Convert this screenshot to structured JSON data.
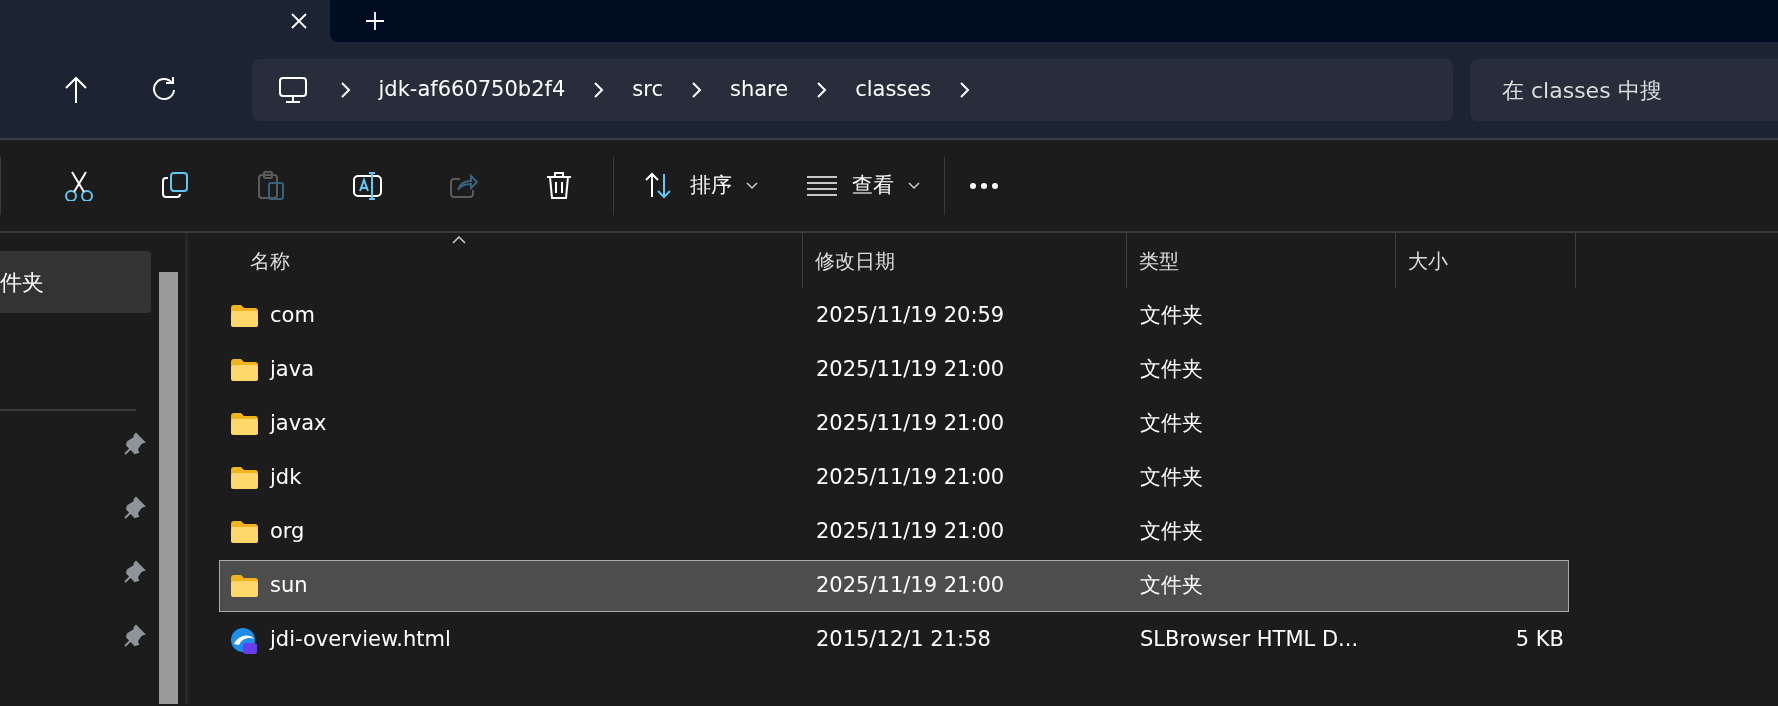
{
  "address_bar": {
    "crumbs": [
      "jdk-af660750b2f4",
      "src",
      "share",
      "classes"
    ]
  },
  "search": {
    "placeholder": "在 classes 中搜"
  },
  "toolbar": {
    "buttons": [
      {
        "kind": "cut",
        "disabled": false
      },
      {
        "kind": "copy",
        "disabled": false
      },
      {
        "kind": "paste",
        "disabled": true
      },
      {
        "kind": "rename",
        "disabled": false
      },
      {
        "kind": "share",
        "disabled": true
      },
      {
        "kind": "delete",
        "disabled": false
      }
    ],
    "menus": [
      {
        "kind": "sort",
        "label": "排序"
      },
      {
        "kind": "view",
        "label": "查看"
      }
    ]
  },
  "nav": {
    "items": [
      {
        "label": "件夹",
        "selected": true
      }
    ],
    "pinned_items": [
      {
        "pinned": true
      },
      {
        "pinned": true
      },
      {
        "pinned": true
      },
      {
        "pinned": true
      }
    ]
  },
  "columns": [
    {
      "label": "名称",
      "sorted": true
    },
    {
      "label": "修改日期",
      "sorted": false
    },
    {
      "label": "类型",
      "sorted": false
    },
    {
      "label": "大小",
      "sorted": false
    }
  ],
  "rows": [
    {
      "kind": "folder",
      "name": "com",
      "modified": "2025/11/19 20:59",
      "type": "文件夹",
      "selected": false
    },
    {
      "kind": "folder",
      "name": "java",
      "modified": "2025/11/19 21:00",
      "type": "文件夹",
      "selected": false
    },
    {
      "kind": "folder",
      "name": "javax",
      "modified": "2025/11/19 21:00",
      "type": "文件夹",
      "selected": false
    },
    {
      "kind": "folder",
      "name": "jdk",
      "modified": "2025/11/19 21:00",
      "type": "文件夹",
      "selected": false
    },
    {
      "kind": "folder",
      "name": "org",
      "modified": "2025/11/19 21:00",
      "type": "文件夹",
      "selected": false
    },
    {
      "kind": "folder",
      "name": "sun",
      "modified": "2025/11/19 21:00",
      "type": "文件夹",
      "selected": true
    },
    {
      "kind": "html",
      "name": "jdi-overview.html",
      "modified": "2015/12/1 21:58",
      "type": "SLBrowser HTML D...",
      "size": "5 KB",
      "selected": false
    }
  ]
}
